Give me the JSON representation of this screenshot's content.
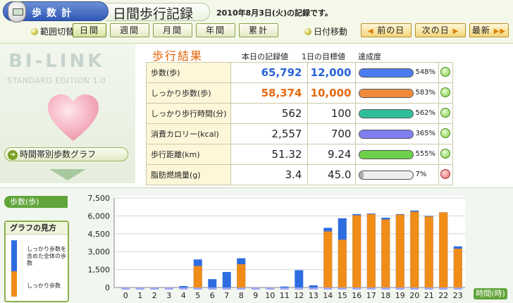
{
  "header": {
    "app_title": "歩数計",
    "screen_title": "日間歩行記録",
    "date_caption": "2010年8月3日(火)の記録です。"
  },
  "toolbar": {
    "range_label": "範囲切替",
    "range_buttons": [
      "日間",
      "週間",
      "月間",
      "年間",
      "累計"
    ],
    "active_range": "日間",
    "datemove_label": "日付移動",
    "prev_day": "前の日",
    "next_day": "次の日",
    "latest": "最新"
  },
  "brand": {
    "logo": "BI-LINK",
    "edition": "STANDARD EDITION 1.0",
    "graph_link": "時間帯別歩数グラフ"
  },
  "results": {
    "title": "歩行結果",
    "col_record": "本日の記録値",
    "col_target": "1日の目標値",
    "col_achieve": "達成度",
    "rows": [
      {
        "label": "歩数(歩)",
        "record": "65,792",
        "target": "12,000",
        "pct": 548,
        "pct_label": "548%",
        "bar_color": "#4a7cf0",
        "val_color": "#2a63d6",
        "big": true,
        "mood": "happy"
      },
      {
        "label": "しっかり歩数(歩)",
        "record": "58,374",
        "target": "10,000",
        "pct": 583,
        "pct_label": "583%",
        "bar_color": "#f08a3a",
        "val_color": "#e56a10",
        "big": true,
        "mood": "happy"
      },
      {
        "label": "しっかり歩行時間(分)",
        "record": "562",
        "target": "100",
        "pct": 562,
        "pct_label": "562%",
        "bar_color": "#2dbf9a",
        "val_color": "#222",
        "big": false,
        "mood": "happy"
      },
      {
        "label": "消費カロリー(kcal)",
        "record": "2,557",
        "target": "700",
        "pct": 365,
        "pct_label": "365%",
        "bar_color": "#7f7ff0",
        "val_color": "#222",
        "big": false,
        "mood": "happy"
      },
      {
        "label": "歩行距離(km)",
        "record": "51.32",
        "target": "9.24",
        "pct": 555,
        "pct_label": "555%",
        "bar_color": "#6cd04a",
        "val_color": "#222",
        "big": false,
        "mood": "happy"
      },
      {
        "label": "脂肪燃焼量(g)",
        "record": "3.4",
        "target": "45.0",
        "pct": 7,
        "pct_label": "7%",
        "bar_color": "#b0b0b0",
        "val_color": "#222",
        "big": false,
        "mood": "sad"
      }
    ]
  },
  "graph": {
    "steps_tag": "歩数(歩)",
    "legend_title": "グラフの見方",
    "legend_total": "しっかり歩数を含めた全体の歩数",
    "legend_firm": "しっかり歩数",
    "xaxis_label": "時間(時)"
  },
  "chart_data": {
    "type": "bar",
    "ylim": [
      0,
      7500
    ],
    "yticks": [
      "0",
      "1,500",
      "3,000",
      "4,500",
      "6,000",
      "7,500"
    ],
    "categories": [
      "0",
      "1",
      "2",
      "3",
      "4",
      "5",
      "6",
      "7",
      "8",
      "9",
      "10",
      "11",
      "12",
      "13",
      "14",
      "15",
      "16",
      "17",
      "18",
      "19",
      "20",
      "21",
      "22",
      "23"
    ],
    "series": [
      {
        "name": "しっかり歩数",
        "color": "#f08c18",
        "values": [
          0,
          0,
          0,
          0,
          0,
          1800,
          0,
          0,
          1950,
          0,
          0,
          0,
          0,
          0,
          4700,
          4000,
          6050,
          6150,
          5700,
          6100,
          6350,
          5950,
          6300,
          3250
        ]
      },
      {
        "name": "全体の歩数",
        "color": "#2e6de0",
        "values": [
          0,
          0,
          0,
          0,
          120,
          2350,
          700,
          1300,
          2450,
          0,
          0,
          80,
          1450,
          180,
          5000,
          5800,
          6150,
          6200,
          5850,
          6150,
          6450,
          6000,
          6300,
          3450
        ]
      }
    ]
  }
}
